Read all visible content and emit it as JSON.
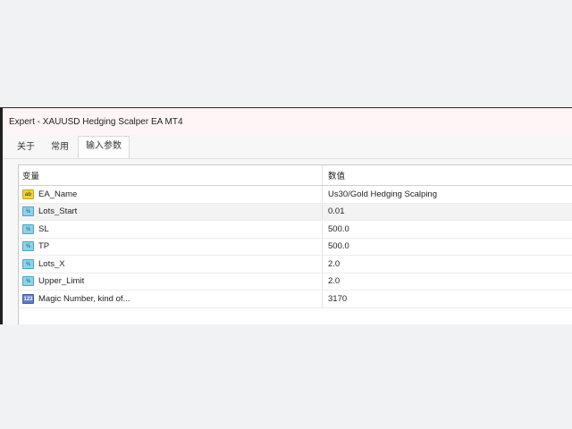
{
  "window": {
    "title": "Expert - XAUUSD Hedging Scalper EA MT4"
  },
  "tabs": [
    {
      "label": "关于",
      "active": false
    },
    {
      "label": "常用",
      "active": false
    },
    {
      "label": "输入参数",
      "active": true
    }
  ],
  "table": {
    "headers": {
      "name": "变量",
      "value": "数值"
    },
    "rows": [
      {
        "icon": "string-param-icon",
        "icon_text": "ab",
        "name": "EA_Name",
        "value": "Us30/Gold Hedging Scalping"
      },
      {
        "icon": "double-param-icon",
        "icon_text": "½",
        "name": "Lots_Start",
        "value": "0.01"
      },
      {
        "icon": "double-param-icon",
        "icon_text": "½",
        "name": "SL",
        "value": "500.0"
      },
      {
        "icon": "double-param-icon",
        "icon_text": "½",
        "name": "TP",
        "value": "500.0"
      },
      {
        "icon": "double-param-icon",
        "icon_text": "½",
        "name": "Lots_X",
        "value": "2.0"
      },
      {
        "icon": "double-param-icon",
        "icon_text": "½",
        "name": "Upper_Limit",
        "value": "2.0"
      },
      {
        "icon": "int-param-icon",
        "icon_text": "123",
        "name": "Magic Number, kind of...",
        "value": "3170"
      }
    ]
  },
  "colors": {
    "string_icon": "#f2d13a",
    "double_icon": "#8fd3ea",
    "int_icon": "#5f7fc9",
    "titlebar": "#fff5f7"
  }
}
